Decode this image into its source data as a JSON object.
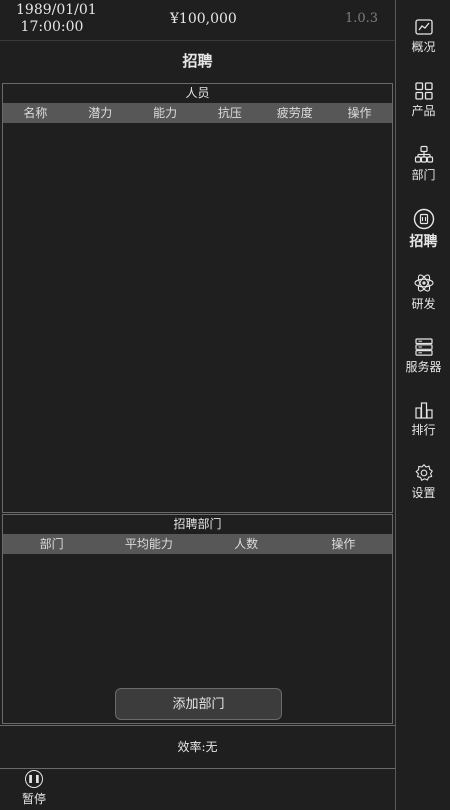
{
  "header": {
    "date": "1989/01/01",
    "time": "17:00:00",
    "money": "¥100,000",
    "version": "1.0.3"
  },
  "page_title": "招聘",
  "staff_panel": {
    "title": "人员",
    "columns": [
      "名称",
      "潜力",
      "能力",
      "抗压",
      "疲劳度",
      "操作"
    ]
  },
  "dept_panel": {
    "title": "招聘部门",
    "columns": [
      "部门",
      "平均能力",
      "人数",
      "操作"
    ],
    "add_button": "添加部门"
  },
  "efficiency": "效率:无",
  "pause": {
    "icon": "pause-icon",
    "label": "暂停"
  },
  "sidebar": {
    "items": [
      {
        "label": "概况",
        "icon": "chart-icon"
      },
      {
        "label": "产品",
        "icon": "grid-icon"
      },
      {
        "label": "部门",
        "icon": "org-chart-icon"
      },
      {
        "label": "招聘",
        "icon": "recruit-icon",
        "active": true
      },
      {
        "label": "研发",
        "icon": "atom-icon"
      },
      {
        "label": "服务器",
        "icon": "server-icon"
      },
      {
        "label": "排行",
        "icon": "ranking-icon"
      },
      {
        "label": "设置",
        "icon": "gear-icon"
      }
    ]
  }
}
